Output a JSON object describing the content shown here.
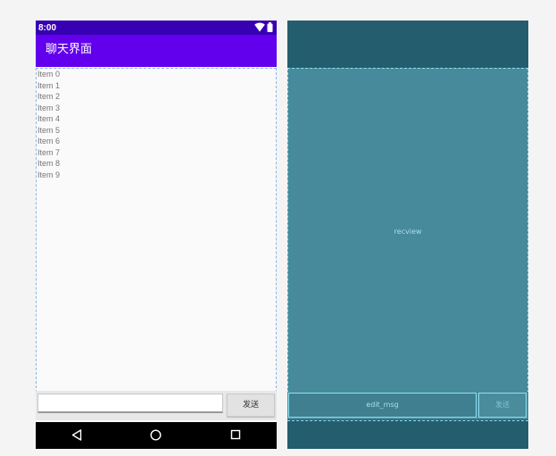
{
  "design": {
    "status_time": "8:00",
    "app_title": "聊天界面",
    "list_items": [
      "Item 0",
      "Item 1",
      "Item 2",
      "Item 3",
      "Item 4",
      "Item 5",
      "Item 6",
      "Item 7",
      "Item 8",
      "Item 9"
    ],
    "input_value": "",
    "send_label": "发送"
  },
  "blueprint": {
    "recycler_id": "recview",
    "edit_id": "edit_msg",
    "send_label": "发送"
  },
  "icons": {
    "wifi": "wifi-icon",
    "battery": "battery-icon",
    "back": "nav-back-icon",
    "home": "nav-home-icon",
    "recents": "nav-recents-icon"
  },
  "colors": {
    "status_bar": "#3700b3",
    "app_bar": "#6200ee",
    "blueprint_bg": "#235d6e",
    "blueprint_fill": "#478a9c",
    "blueprint_line": "#8ee0f2"
  }
}
